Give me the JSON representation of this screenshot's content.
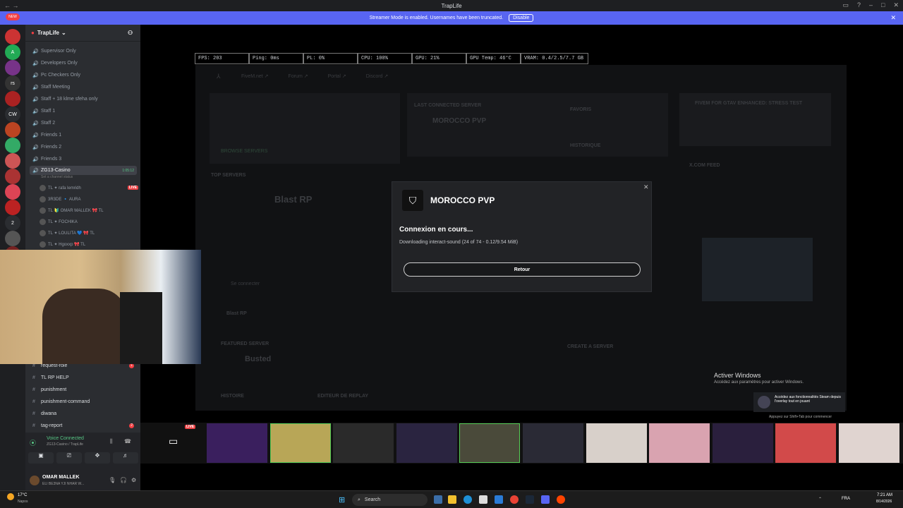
{
  "window": {
    "title": "TrapLife"
  },
  "banner": {
    "text": "Streamer Mode is enabled. Usernames have been truncated.",
    "button": "Disable"
  },
  "rail": {
    "new_label": "NEW",
    "servers": [
      {
        "label": "",
        "badge": "164"
      },
      {
        "label": "A",
        "badge": ""
      },
      {
        "label": "",
        "badge": "268"
      },
      {
        "label": "rs",
        "badge": ""
      },
      {
        "label": "",
        "badge": "226"
      },
      {
        "label": "CW",
        "badge": ""
      },
      {
        "label": "",
        "badge": "189"
      },
      {
        "label": "",
        "badge": "899"
      },
      {
        "label": "",
        "badge": "1K+"
      },
      {
        "label": "",
        "badge": "936"
      },
      {
        "label": "",
        "badge": "1K+"
      },
      {
        "label": "",
        "badge": "192"
      },
      {
        "label": "2",
        "badge": ""
      },
      {
        "label": "",
        "badge": "4"
      },
      {
        "label": "",
        "badge": "1"
      }
    ]
  },
  "guild": {
    "name": "TrapLife"
  },
  "channels": [
    {
      "name": "Supervisor Only"
    },
    {
      "name": "Developers Only"
    },
    {
      "name": "Pc Checkers Only"
    },
    {
      "name": "Staff Meeting"
    },
    {
      "name": "Staff + 18 klme sfeha only"
    },
    {
      "name": "Staff 1"
    },
    {
      "name": "Staff 2"
    },
    {
      "name": "Friends 1"
    },
    {
      "name": "Friends 2"
    },
    {
      "name": "Friends 3"
    }
  ],
  "active_channel": {
    "name": "ZG13-Casino",
    "timer": "1:05:12",
    "status": "Set a channel status"
  },
  "voice_members": [
    {
      "name": "TL ✦ rafa lemridh",
      "live": "LIVE"
    },
    {
      "name": "3R3DE 🔹 AURA",
      "live": ""
    },
    {
      "name": "TL 🔰 OMAR MALLEK 🎀 TL",
      "live": ""
    },
    {
      "name": "TL ✦ FOCHIKA",
      "live": ""
    },
    {
      "name": "TL ✦ LOULITA 💙 🎀 TL",
      "live": ""
    },
    {
      "name": "TL ✦ Hgoxxp 🎀 TL",
      "live": ""
    }
  ],
  "text_channels": [
    {
      "name": "request-role",
      "badge": "1"
    },
    {
      "name": "TL RP HELP",
      "badge": ""
    },
    {
      "name": "punishment",
      "badge": ""
    },
    {
      "name": "punishment-command",
      "badge": ""
    },
    {
      "name": "diwana",
      "badge": ""
    },
    {
      "name": "tag-report",
      "badge": "2"
    }
  ],
  "voice_panel": {
    "status": "Voice Connected",
    "channel": "ZG13-Casino / TrapLife",
    "user": "OMAR MALLEK",
    "user_status": "ELI BE3NA YJI NHAR W..."
  },
  "perf": {
    "fps": "FPS: 203",
    "ping": "Ping: 0ms",
    "pl": "PL: 0%",
    "cpu": "CPU: 100%",
    "gpu": "GPU: 21%",
    "gpu_temp": "GPU Temp: 46°C",
    "vram": "VRAM: 0.4/2.5/7.7 GB"
  },
  "fivem": {
    "nav": [
      "FiveM.net ↗",
      "Forum ↗",
      "Portal ↗",
      "Discord ↗"
    ],
    "last_server_label": "LAST CONNECTED SERVER",
    "last_server_name": "MOROCCO PVP",
    "favoris": "FAVORIS",
    "historique": "HISTORIQUE",
    "browse": "BROWSE SERVERS",
    "top_servers": "TOP SERVERS",
    "top_name": "Blast RP",
    "featured": "FEATURED SERVER",
    "featured_name": "Busted",
    "create": "CREATE A SERVER",
    "news_title": "FIVEM FOR GTAV ENHANCED: STRESS TEST",
    "xcom": "X.COM FEED",
    "history_btn": "HISTOIRE",
    "replay_btn": "EDITEUR DE REPLAY",
    "blast": "Blast RP",
    "connect": "Se connecter"
  },
  "modal": {
    "title": "MOROCCO PVP",
    "status": "Connexion en cours...",
    "progress": "Downloading interact-sound (24 of 74 - 0.12/9.54 MiB)",
    "button": "Retour"
  },
  "windows_watermark": {
    "title": "Activer Windows",
    "sub": "Accédez aux paramètres pour activer Windows."
  },
  "steam": {
    "text": "Accédez aux fonctionnalités Steam depuis l'overlay tout en jouant",
    "hint": "Appuyez sur Shift+Tab pour commencer"
  },
  "tiles": {
    "live": "LIVE"
  },
  "taskbar": {
    "weather_temp": "17°C",
    "weather_loc": "Napos",
    "search": "Search",
    "lang": "FRA",
    "time": "7:21 AM",
    "date": "8/14/2026"
  }
}
